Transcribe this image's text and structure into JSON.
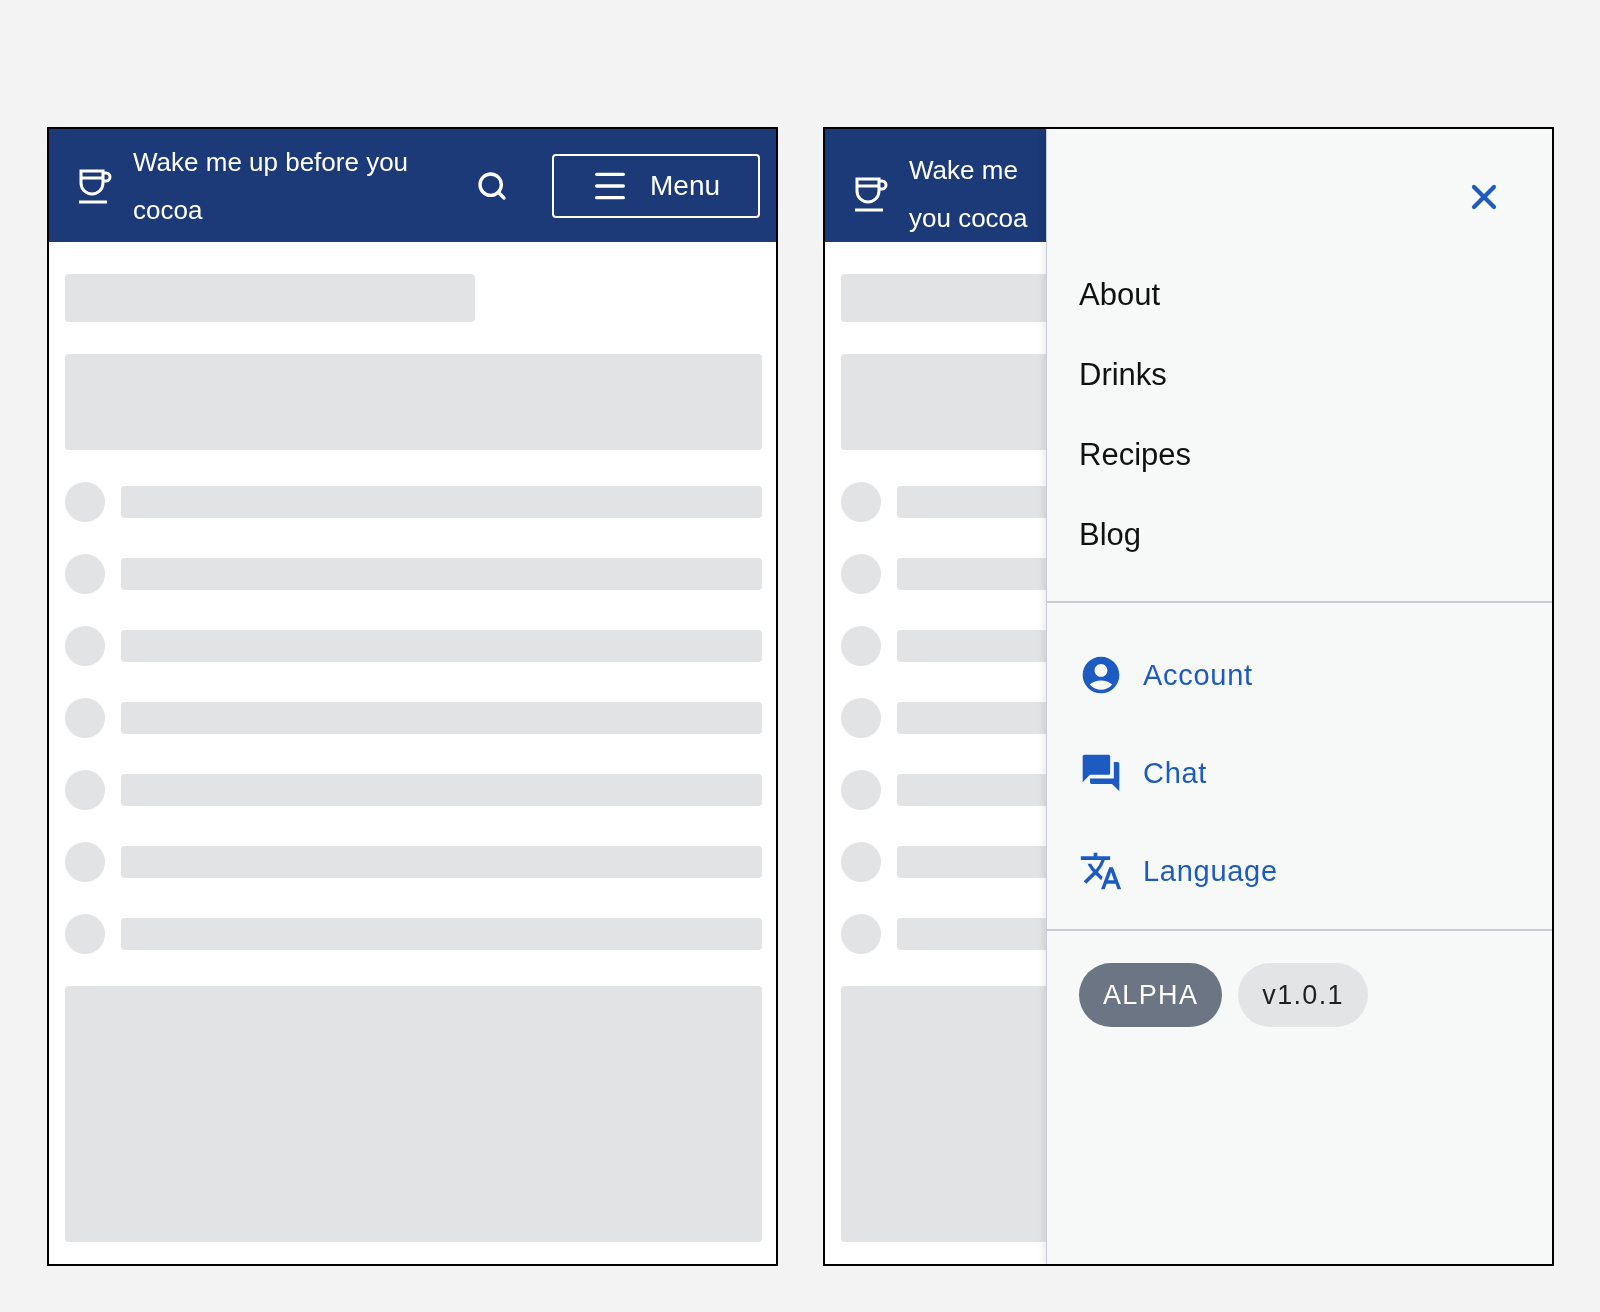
{
  "header": {
    "title": "Wake me up before you cocoa",
    "menu_button": "Menu"
  },
  "drawer": {
    "background_title_lines": [
      "Wake me",
      "you cocoa"
    ],
    "nav": [
      {
        "label": "About"
      },
      {
        "label": "Drinks"
      },
      {
        "label": "Recipes"
      },
      {
        "label": "Blog"
      }
    ],
    "links": [
      {
        "label": "Account",
        "kind": "account"
      },
      {
        "label": "Chat",
        "kind": "chat"
      },
      {
        "label": "Language",
        "kind": "language"
      }
    ],
    "badges": [
      {
        "label": "ALPHA",
        "kind": "dark"
      },
      {
        "label": "v1.0.1",
        "kind": "light"
      }
    ]
  }
}
